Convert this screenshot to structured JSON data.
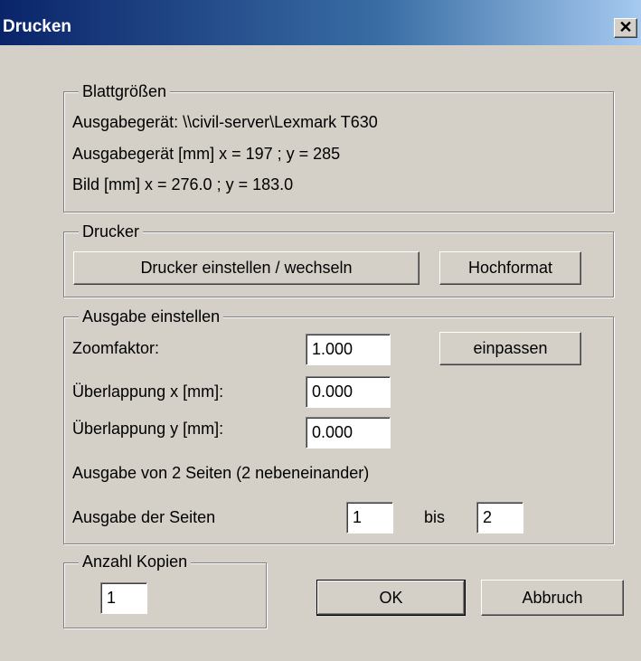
{
  "window": {
    "title": "Drucken",
    "close_glyph": "✕"
  },
  "blattgroessen": {
    "legend": "Blattgrößen",
    "line1": "Ausgabegerät: \\\\civil-server\\Lexmark T630",
    "line2": "Ausgabegerät [mm]   x = 197 ; y = 285",
    "line3": "Bild [mm]   x = 276.0 ; y = 183.0"
  },
  "drucker": {
    "legend": "Drucker",
    "setup_button": "Drucker einstellen / wechseln",
    "orientation_button": "Hochformat"
  },
  "ausgabe": {
    "legend": "Ausgabe einstellen",
    "zoom_label": "Zoomfaktor:",
    "zoom_value": "1.000",
    "fit_button": "einpassen",
    "overlap_x_label": "Überlappung x [mm]:",
    "overlap_x_value": "0.000",
    "overlap_y_label": "Überlappung y [mm]:",
    "overlap_y_value": "0.000",
    "pages_info": "Ausgabe von 2 Seiten (2 nebeneinander)",
    "pages_label": "Ausgabe der Seiten",
    "page_from": "1",
    "to_label": "bis",
    "page_to": "2"
  },
  "kopien": {
    "legend": "Anzahl Kopien",
    "value": "1"
  },
  "buttons": {
    "ok": "OK",
    "cancel": "Abbruch"
  }
}
